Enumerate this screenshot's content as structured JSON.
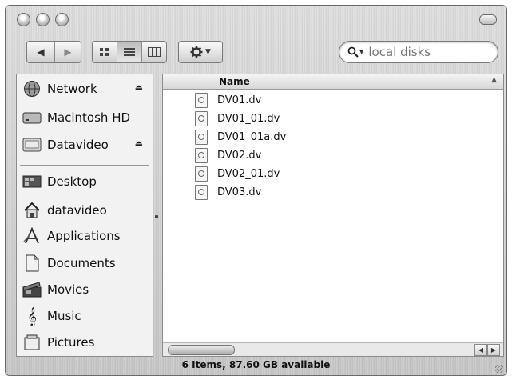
{
  "toolbar": {
    "search_placeholder": "local disks",
    "view_modes": [
      "icon",
      "list",
      "column"
    ],
    "action_icon": "gear-icon"
  },
  "sidebar": {
    "devices": [
      {
        "label": "Network",
        "icon": "network-globe-icon",
        "eject": true
      },
      {
        "label": "Macintosh HD",
        "icon": "hard-drive-icon",
        "eject": false
      },
      {
        "label": "Datavideo",
        "icon": "external-drive-icon",
        "eject": true
      }
    ],
    "places": [
      {
        "label": "Desktop",
        "icon": "desktop-icon"
      },
      {
        "label": "datavideo",
        "icon": "home-icon"
      },
      {
        "label": "Applications",
        "icon": "applications-icon"
      },
      {
        "label": "Documents",
        "icon": "documents-icon"
      },
      {
        "label": "Movies",
        "icon": "movies-icon"
      },
      {
        "label": "Music",
        "icon": "music-icon"
      },
      {
        "label": "Pictures",
        "icon": "pictures-icon"
      }
    ]
  },
  "file_list": {
    "column_header": "Name",
    "files": [
      "DV01.dv",
      "DV01_01.dv",
      "DV01_01a.dv",
      "DV02.dv",
      "DV02_01.dv",
      "DV03.dv"
    ]
  },
  "status_bar": {
    "text": "6 Items, 87.60 GB available"
  }
}
